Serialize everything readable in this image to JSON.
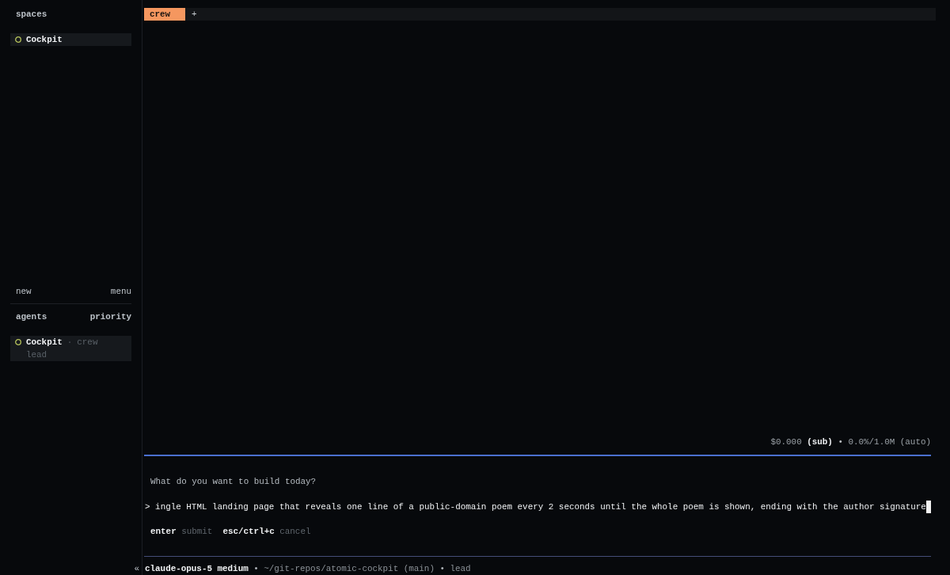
{
  "sidebar": {
    "spaces": {
      "title": "spaces",
      "items": [
        {
          "label": "Cockpit",
          "selected": true
        }
      ]
    },
    "actions": {
      "new": "new",
      "menu": "menu"
    },
    "agents": {
      "title": "agents",
      "sort": "priority",
      "items": [
        {
          "name": "Cockpit",
          "separator": "·",
          "tab": "crew",
          "role": "lead",
          "selected": true
        }
      ]
    },
    "collapse": "«"
  },
  "tabs": [
    {
      "label": "crew",
      "selected": true
    }
  ],
  "add_tab": "+",
  "usage": {
    "cost": "$0.000",
    "plan": "(sub)",
    "separator": "•",
    "context": "0.0%/1.0M (auto)"
  },
  "prompt": {
    "question": "What do you want to build today?",
    "marker": ">",
    "value": "ingle HTML landing page that reveals one line of a public-domain poem every 2 seconds until the whole poem is shown, ending with the author signature",
    "hints": [
      {
        "key": "enter",
        "action": "submit"
      },
      {
        "key": "esc/ctrl+c",
        "action": "cancel"
      }
    ]
  },
  "status_bar": {
    "model": "claude-opus-5 medium",
    "segments": [
      {
        "separator": "•",
        "text": "~/git-repos/atomic-cockpit (main)"
      },
      {
        "separator": "•",
        "text": "lead"
      }
    ]
  }
}
